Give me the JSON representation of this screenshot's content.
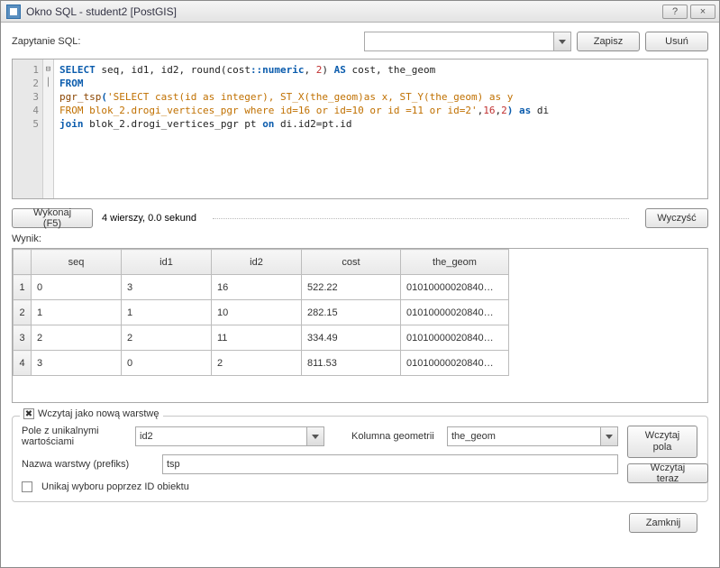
{
  "window": {
    "title": "Okno SQL - student2 [PostGIS]",
    "help_btn": "?",
    "close_btn": "×"
  },
  "toolbar": {
    "query_label": "Zapytanie SQL:",
    "save_label": "Zapisz",
    "delete_label": "Usuń"
  },
  "editor": {
    "lines": [
      "1",
      "2",
      "3",
      "4",
      "5"
    ],
    "fold": [
      "",
      "",
      "⊟",
      "│",
      ""
    ]
  },
  "code": {
    "l1_select": "SELECT",
    "l1_rest1": " seq, id1, id2, round(cost",
    "l1_cast": "::numeric",
    "l1_rest2": ", ",
    "l1_num": "2",
    "l1_rest3": ") ",
    "l1_as": "AS",
    "l1_rest4": " cost, the_geom",
    "l2_from": "FROM",
    "l3_fn": "pgr_tsp",
    "l3_p": "(",
    "l3_str": "'SELECT cast(id as integer), ST_X(the_geom)as x, ST_Y(the_geom) as y",
    "l4_str": "FROM blok_2.drogi_vertices_pgr where id=16 or id=10 or id =11 or id=2'",
    "l4_rest": ",",
    "l4_n1": "16",
    "l4_c": ",",
    "l4_n2": "2",
    "l4_close": ")",
    "l4_as": " as",
    "l4_alias": " di",
    "l5_join": "join",
    "l5_rest1": " blok_2.drogi_vertices_pgr pt ",
    "l5_on": "on",
    "l5_rest2": " di.id2=pt.id"
  },
  "actions": {
    "execute_label": "Wykonaj (F5)",
    "status": "4 wierszy, 0.0 sekund",
    "clear_label": "Wyczyść"
  },
  "result": {
    "label": "Wynik:",
    "columns": [
      "seq",
      "id1",
      "id2",
      "cost",
      "the_geom"
    ],
    "rows": [
      {
        "n": "1",
        "seq": "0",
        "id1": "3",
        "id2": "16",
        "cost": "522.22",
        "geom": "01010000020840…"
      },
      {
        "n": "2",
        "seq": "1",
        "id1": "1",
        "id2": "10",
        "cost": "282.15",
        "geom": "01010000020840…"
      },
      {
        "n": "3",
        "seq": "2",
        "id1": "2",
        "id2": "11",
        "cost": "334.49",
        "geom": "01010000020840…"
      },
      {
        "n": "4",
        "seq": "3",
        "id1": "0",
        "id2": "2",
        "cost": "811.53",
        "geom": "01010000020840…"
      }
    ]
  },
  "layer": {
    "header_checked": "✖",
    "header_label": "Wczytaj jako nową warstwę",
    "unique_label": "Pole z unikalnymi wartościami",
    "unique_value": "id2",
    "geom_label": "Kolumna geometrii",
    "geom_value": "the_geom",
    "prefix_label": "Nazwa warstwy (prefiks)",
    "prefix_value": "tsp",
    "avoid_label": "Unikaj wyboru poprzez ID obiektu",
    "load_fields_label": "Wczytaj\npola",
    "load_now_label": "Wczytaj teraz"
  },
  "footer": {
    "close_label": "Zamknij"
  },
  "chart_data": {
    "type": "table",
    "title": "Wynik",
    "columns": [
      "seq",
      "id1",
      "id2",
      "cost",
      "the_geom"
    ],
    "rows": [
      [
        0,
        3,
        16,
        522.22,
        "01010000020840…"
      ],
      [
        1,
        1,
        10,
        282.15,
        "01010000020840…"
      ],
      [
        2,
        2,
        11,
        334.49,
        "01010000020840…"
      ],
      [
        3,
        0,
        2,
        811.53,
        "01010000020840…"
      ]
    ]
  }
}
